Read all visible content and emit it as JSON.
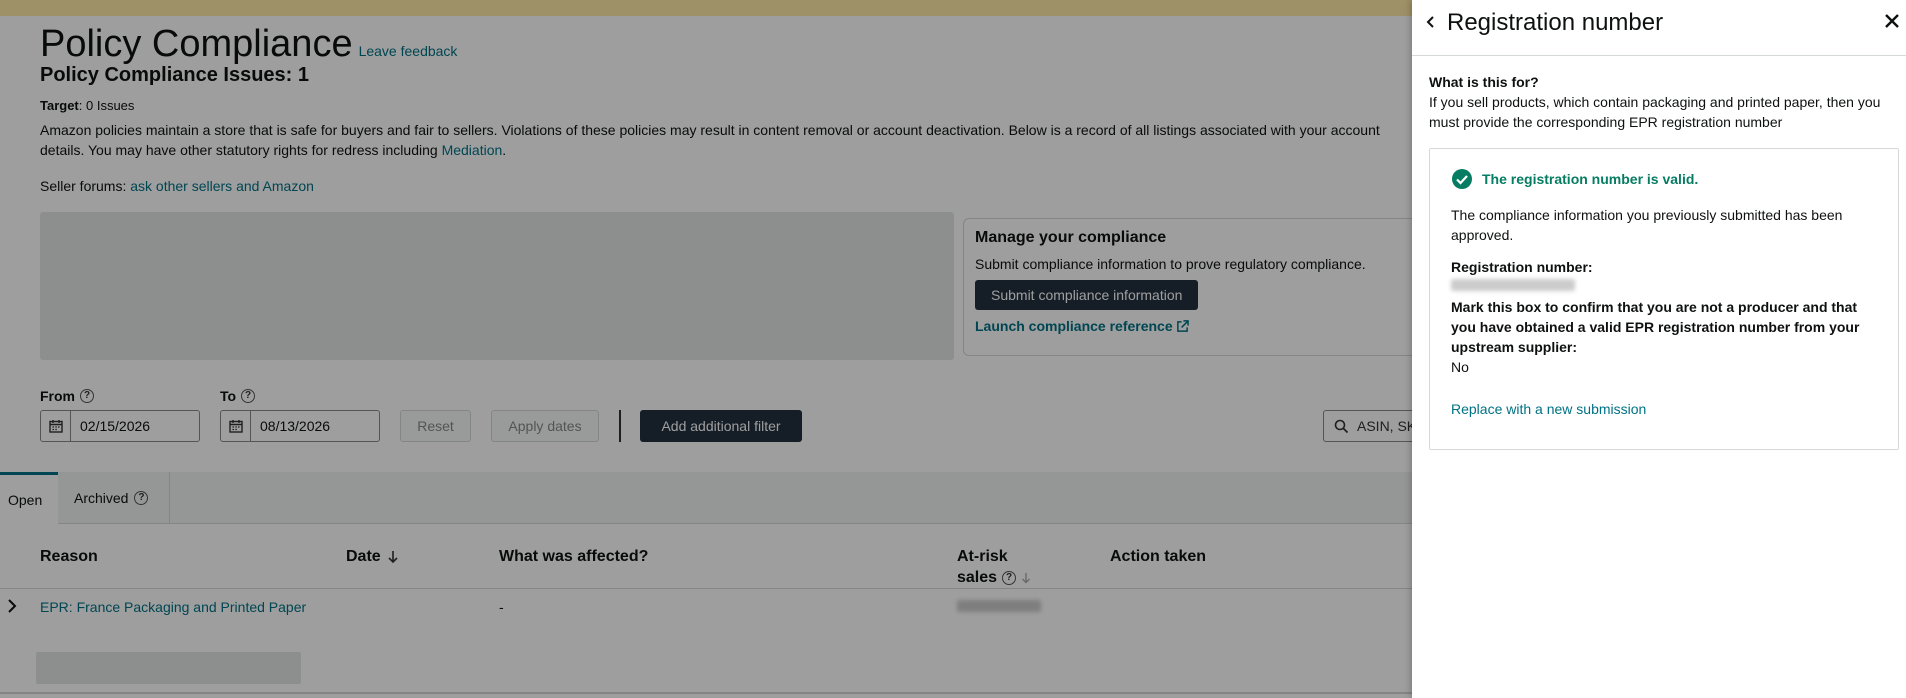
{
  "page": {
    "title": "Policy Compliance",
    "feedback_link": "Leave feedback",
    "issues_label": "Policy Compliance Issues: 1",
    "target_label": "Target",
    "target_value": ": 0 Issues",
    "description_line1": "Amazon policies maintain a store that is safe for buyers and fair to sellers. Violations of these policies may result in content removal or account deactivation. Below is a record of all listings associated with your account",
    "description_line2": "details. You may have other statutory rights for redress including ",
    "mediation_link": "Mediation",
    "forums_label": "Seller forums: ",
    "forums_link": "ask other sellers and Amazon"
  },
  "manage": {
    "title": "Manage your compliance",
    "description": "Submit compliance information to prove regulatory compliance.",
    "submit_button": "Submit compliance information",
    "launch_link": "Launch compliance reference"
  },
  "filters": {
    "from_label": "From",
    "to_label": "To",
    "from_value": "02/15/2026",
    "to_value": "08/13/2026",
    "reset_button": "Reset",
    "apply_button": "Apply dates",
    "add_filter_button": "Add additional filter",
    "search_placeholder": "ASIN, SKU"
  },
  "tabs": [
    {
      "label": "Open",
      "active": true
    },
    {
      "label": "Archived",
      "active": false
    }
  ],
  "table": {
    "headers": {
      "reason": "Reason",
      "date": "Date",
      "affected": "What was affected?",
      "at_risk_line1": "At-risk",
      "at_risk_line2": "sales",
      "action": "Action taken"
    },
    "rows": [
      {
        "reason": "EPR: France Packaging and Printed Paper",
        "affected": "-"
      }
    ]
  },
  "panel": {
    "title": "Registration number",
    "question": "What is this for?",
    "answer": "If you sell products, which contain packaging and printed paper, then you must provide the corresponding EPR registration number",
    "status": "The registration number is valid.",
    "status_detail": "The compliance information you previously submitted has been approved.",
    "reg_label": "Registration number:",
    "confirm_label": "Mark this box to confirm that you are not a producer and that you have obtained a valid EPR registration number from your upstream supplier:",
    "confirm_value": "No",
    "replace_link": "Replace with a new submission"
  },
  "colors": {
    "accent": "#007185",
    "dark_button": "#232f3e",
    "valid_green": "#067d62",
    "top_banner": "#ffe9a6"
  }
}
